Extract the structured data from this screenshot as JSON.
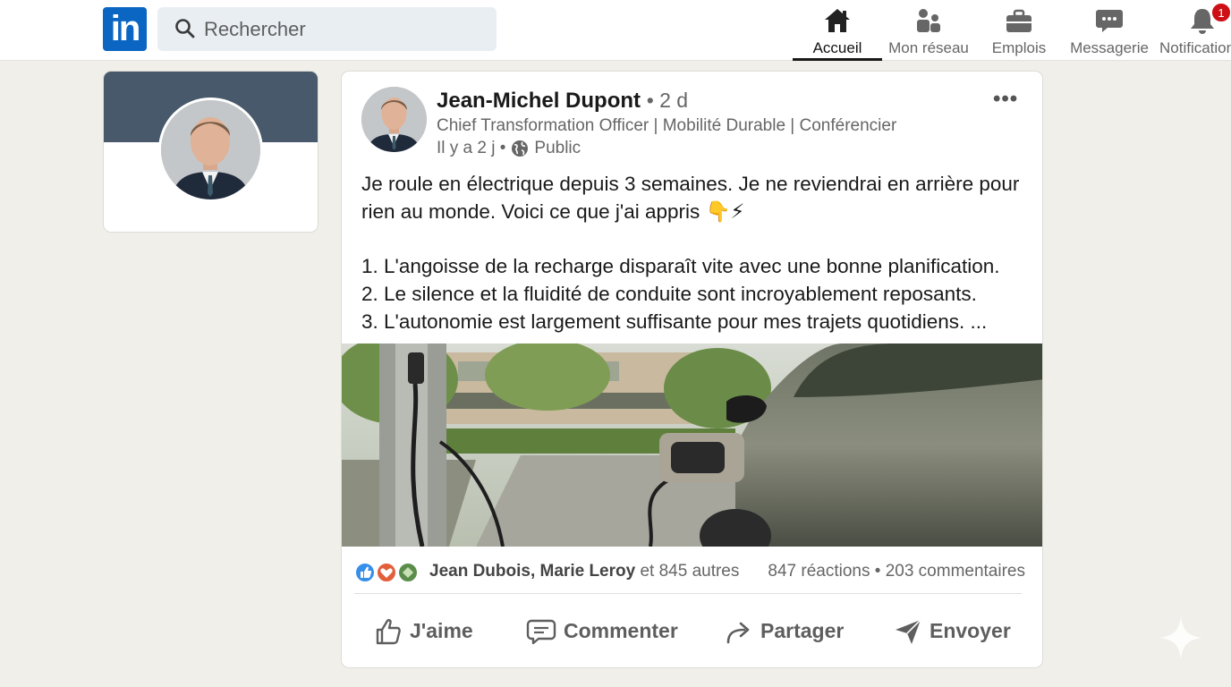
{
  "topbar": {
    "logo_text": "in",
    "search_placeholder": "Rechercher",
    "nav": [
      {
        "label": "Accueil",
        "icon": "home-icon",
        "active": true
      },
      {
        "label": "Mon réseau",
        "icon": "network-icon"
      },
      {
        "label": "Emplois",
        "icon": "briefcase-icon"
      },
      {
        "label": "Messagerie",
        "icon": "messaging-icon"
      },
      {
        "label": "Notifications",
        "icon": "bell-icon",
        "badge": "1"
      }
    ]
  },
  "post": {
    "author": "Jean-Michel Dupont",
    "time_short": "• 2 d",
    "headline": "Chief Transformation Officer | Mobilité Durable | Conférencier",
    "time_long": "Il y a 2 j •",
    "visibility": "Public",
    "text_lines": [
      "Je roule en électrique depuis 3 semaines. Je ne reviendrai en arrière pour",
      "rien au monde. Voici ce que j'ai appris 👇⚡",
      "1. L'angoisse de la recharge disparaît vite avec une bonne planification.",
      "2. Le silence et la fluidité de conduite sont incroyablement reposants.",
      "3. L'autonomie est largement suffisante pour mes trajets quotidiens. ..."
    ],
    "reactors_names": "Jean Dubois, Marie Leroy",
    "reactors_rest": " et 845 autres",
    "reaction_count": "847 réactions",
    "comment_count": "• 203 commentaires",
    "actions": {
      "like": "J'aime",
      "comment": "Commenter",
      "share": "Partager",
      "send": "Envoyer"
    }
  },
  "colors": {
    "brand": "#0a66c2",
    "banner": "#47596a",
    "badge": "#cc1016"
  }
}
